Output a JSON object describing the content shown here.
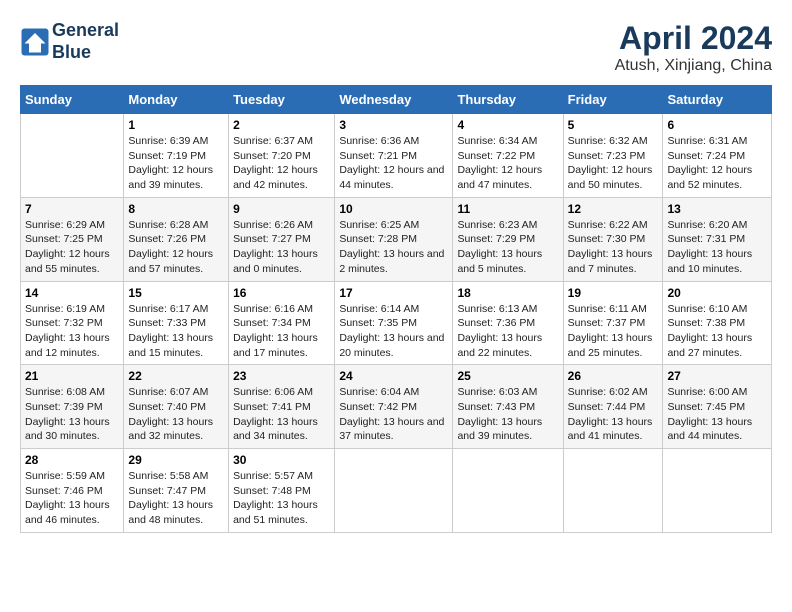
{
  "header": {
    "logo_line1": "General",
    "logo_line2": "Blue",
    "main_title": "April 2024",
    "subtitle": "Atush, Xinjiang, China"
  },
  "days_of_week": [
    "Sunday",
    "Monday",
    "Tuesday",
    "Wednesday",
    "Thursday",
    "Friday",
    "Saturday"
  ],
  "weeks": [
    [
      {
        "day": "",
        "sunrise": "",
        "sunset": "",
        "daylight": ""
      },
      {
        "day": "1",
        "sunrise": "Sunrise: 6:39 AM",
        "sunset": "Sunset: 7:19 PM",
        "daylight": "Daylight: 12 hours and 39 minutes."
      },
      {
        "day": "2",
        "sunrise": "Sunrise: 6:37 AM",
        "sunset": "Sunset: 7:20 PM",
        "daylight": "Daylight: 12 hours and 42 minutes."
      },
      {
        "day": "3",
        "sunrise": "Sunrise: 6:36 AM",
        "sunset": "Sunset: 7:21 PM",
        "daylight": "Daylight: 12 hours and 44 minutes."
      },
      {
        "day": "4",
        "sunrise": "Sunrise: 6:34 AM",
        "sunset": "Sunset: 7:22 PM",
        "daylight": "Daylight: 12 hours and 47 minutes."
      },
      {
        "day": "5",
        "sunrise": "Sunrise: 6:32 AM",
        "sunset": "Sunset: 7:23 PM",
        "daylight": "Daylight: 12 hours and 50 minutes."
      },
      {
        "day": "6",
        "sunrise": "Sunrise: 6:31 AM",
        "sunset": "Sunset: 7:24 PM",
        "daylight": "Daylight: 12 hours and 52 minutes."
      }
    ],
    [
      {
        "day": "7",
        "sunrise": "Sunrise: 6:29 AM",
        "sunset": "Sunset: 7:25 PM",
        "daylight": "Daylight: 12 hours and 55 minutes."
      },
      {
        "day": "8",
        "sunrise": "Sunrise: 6:28 AM",
        "sunset": "Sunset: 7:26 PM",
        "daylight": "Daylight: 12 hours and 57 minutes."
      },
      {
        "day": "9",
        "sunrise": "Sunrise: 6:26 AM",
        "sunset": "Sunset: 7:27 PM",
        "daylight": "Daylight: 13 hours and 0 minutes."
      },
      {
        "day": "10",
        "sunrise": "Sunrise: 6:25 AM",
        "sunset": "Sunset: 7:28 PM",
        "daylight": "Daylight: 13 hours and 2 minutes."
      },
      {
        "day": "11",
        "sunrise": "Sunrise: 6:23 AM",
        "sunset": "Sunset: 7:29 PM",
        "daylight": "Daylight: 13 hours and 5 minutes."
      },
      {
        "day": "12",
        "sunrise": "Sunrise: 6:22 AM",
        "sunset": "Sunset: 7:30 PM",
        "daylight": "Daylight: 13 hours and 7 minutes."
      },
      {
        "day": "13",
        "sunrise": "Sunrise: 6:20 AM",
        "sunset": "Sunset: 7:31 PM",
        "daylight": "Daylight: 13 hours and 10 minutes."
      }
    ],
    [
      {
        "day": "14",
        "sunrise": "Sunrise: 6:19 AM",
        "sunset": "Sunset: 7:32 PM",
        "daylight": "Daylight: 13 hours and 12 minutes."
      },
      {
        "day": "15",
        "sunrise": "Sunrise: 6:17 AM",
        "sunset": "Sunset: 7:33 PM",
        "daylight": "Daylight: 13 hours and 15 minutes."
      },
      {
        "day": "16",
        "sunrise": "Sunrise: 6:16 AM",
        "sunset": "Sunset: 7:34 PM",
        "daylight": "Daylight: 13 hours and 17 minutes."
      },
      {
        "day": "17",
        "sunrise": "Sunrise: 6:14 AM",
        "sunset": "Sunset: 7:35 PM",
        "daylight": "Daylight: 13 hours and 20 minutes."
      },
      {
        "day": "18",
        "sunrise": "Sunrise: 6:13 AM",
        "sunset": "Sunset: 7:36 PM",
        "daylight": "Daylight: 13 hours and 22 minutes."
      },
      {
        "day": "19",
        "sunrise": "Sunrise: 6:11 AM",
        "sunset": "Sunset: 7:37 PM",
        "daylight": "Daylight: 13 hours and 25 minutes."
      },
      {
        "day": "20",
        "sunrise": "Sunrise: 6:10 AM",
        "sunset": "Sunset: 7:38 PM",
        "daylight": "Daylight: 13 hours and 27 minutes."
      }
    ],
    [
      {
        "day": "21",
        "sunrise": "Sunrise: 6:08 AM",
        "sunset": "Sunset: 7:39 PM",
        "daylight": "Daylight: 13 hours and 30 minutes."
      },
      {
        "day": "22",
        "sunrise": "Sunrise: 6:07 AM",
        "sunset": "Sunset: 7:40 PM",
        "daylight": "Daylight: 13 hours and 32 minutes."
      },
      {
        "day": "23",
        "sunrise": "Sunrise: 6:06 AM",
        "sunset": "Sunset: 7:41 PM",
        "daylight": "Daylight: 13 hours and 34 minutes."
      },
      {
        "day": "24",
        "sunrise": "Sunrise: 6:04 AM",
        "sunset": "Sunset: 7:42 PM",
        "daylight": "Daylight: 13 hours and 37 minutes."
      },
      {
        "day": "25",
        "sunrise": "Sunrise: 6:03 AM",
        "sunset": "Sunset: 7:43 PM",
        "daylight": "Daylight: 13 hours and 39 minutes."
      },
      {
        "day": "26",
        "sunrise": "Sunrise: 6:02 AM",
        "sunset": "Sunset: 7:44 PM",
        "daylight": "Daylight: 13 hours and 41 minutes."
      },
      {
        "day": "27",
        "sunrise": "Sunrise: 6:00 AM",
        "sunset": "Sunset: 7:45 PM",
        "daylight": "Daylight: 13 hours and 44 minutes."
      }
    ],
    [
      {
        "day": "28",
        "sunrise": "Sunrise: 5:59 AM",
        "sunset": "Sunset: 7:46 PM",
        "daylight": "Daylight: 13 hours and 46 minutes."
      },
      {
        "day": "29",
        "sunrise": "Sunrise: 5:58 AM",
        "sunset": "Sunset: 7:47 PM",
        "daylight": "Daylight: 13 hours and 48 minutes."
      },
      {
        "day": "30",
        "sunrise": "Sunrise: 5:57 AM",
        "sunset": "Sunset: 7:48 PM",
        "daylight": "Daylight: 13 hours and 51 minutes."
      },
      {
        "day": "",
        "sunrise": "",
        "sunset": "",
        "daylight": ""
      },
      {
        "day": "",
        "sunrise": "",
        "sunset": "",
        "daylight": ""
      },
      {
        "day": "",
        "sunrise": "",
        "sunset": "",
        "daylight": ""
      },
      {
        "day": "",
        "sunrise": "",
        "sunset": "",
        "daylight": ""
      }
    ]
  ]
}
